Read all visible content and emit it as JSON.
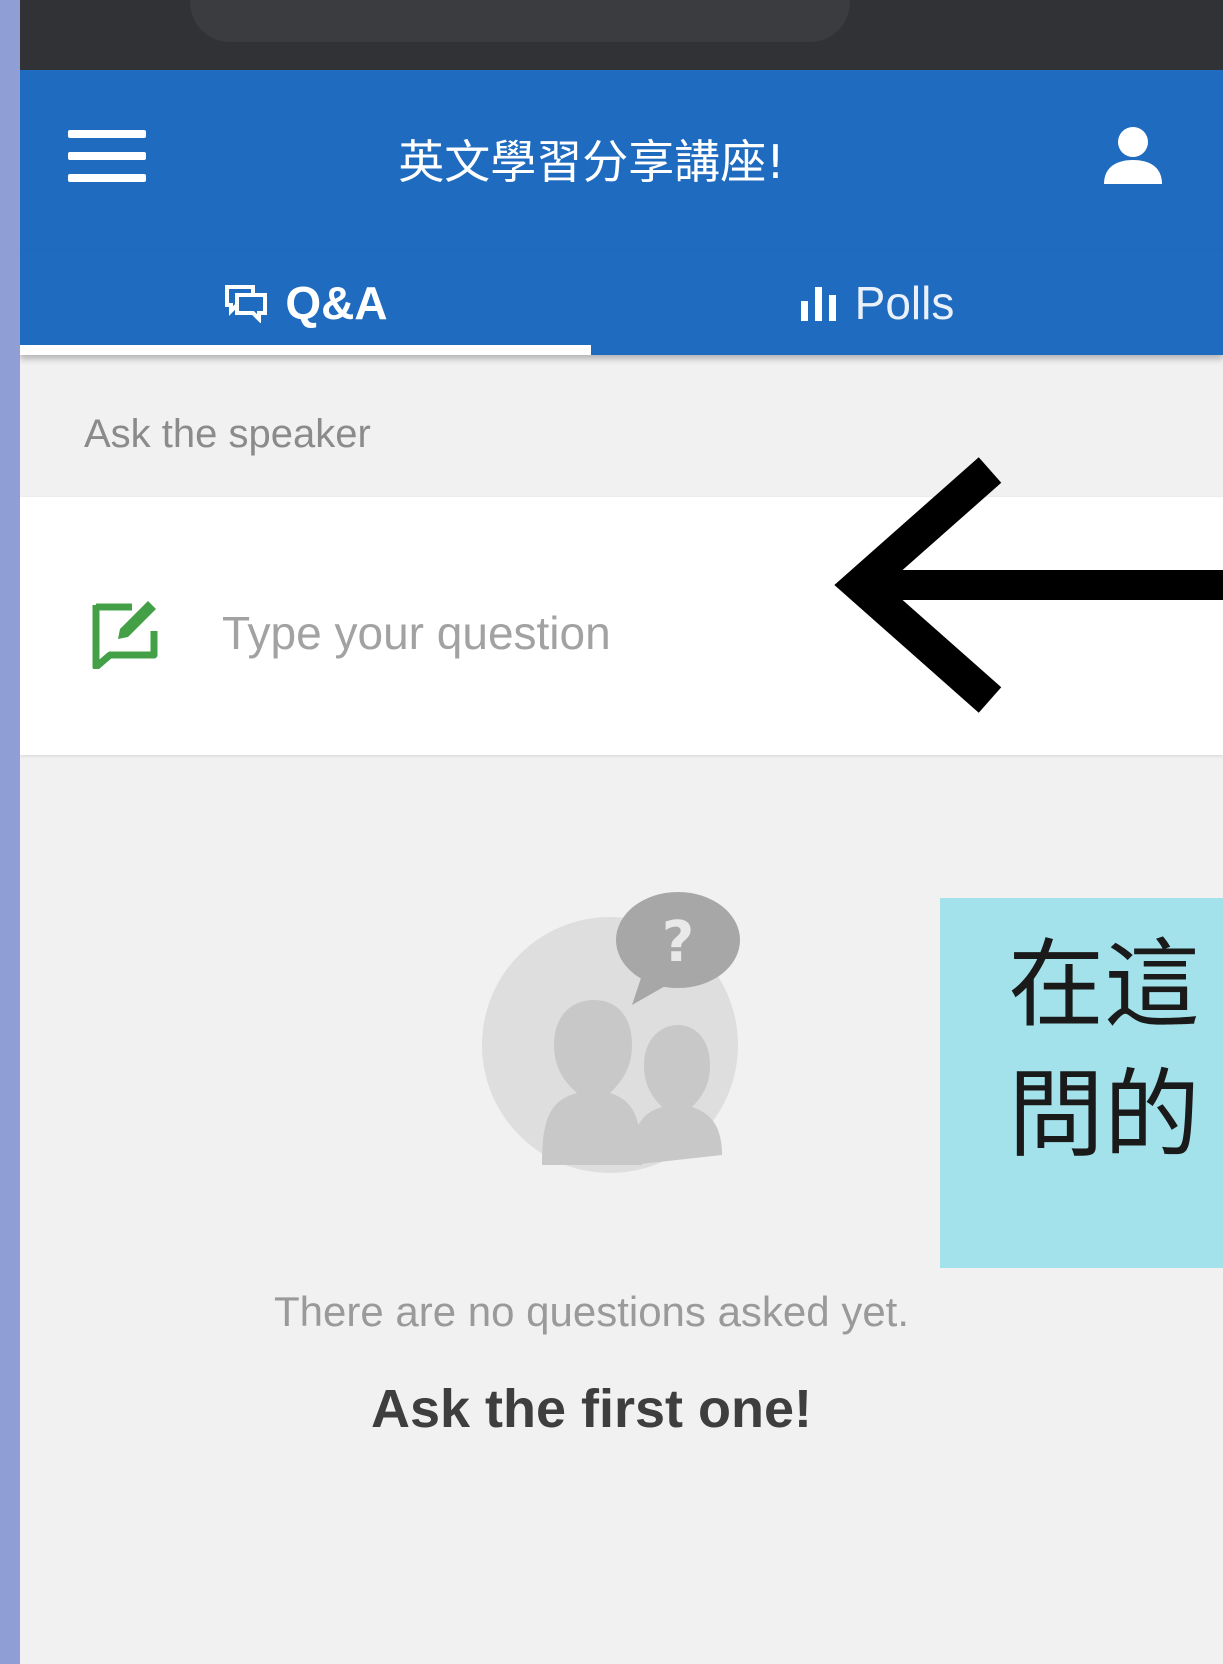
{
  "app_bar": {
    "title": "英文學習分享講座!"
  },
  "tabs": [
    {
      "label": "Q&A",
      "icon": "chat-bubbles-icon",
      "active": true
    },
    {
      "label": "Polls",
      "icon": "bar-chart-icon",
      "active": false
    }
  ],
  "qa": {
    "section_label": "Ask the speaker",
    "input_placeholder": "Type your question",
    "input_value": ""
  },
  "empty_state": {
    "message": "There are no questions asked yet.",
    "cta": "Ask the first one!"
  },
  "annotation": {
    "note_text": "在這\n問的"
  },
  "colors": {
    "primary": "#1f6bbf",
    "accent_green": "#43a047",
    "background": "#f1f1f1",
    "outer_frame": "#8f9fd6",
    "note_background": "#a3e2ea"
  }
}
